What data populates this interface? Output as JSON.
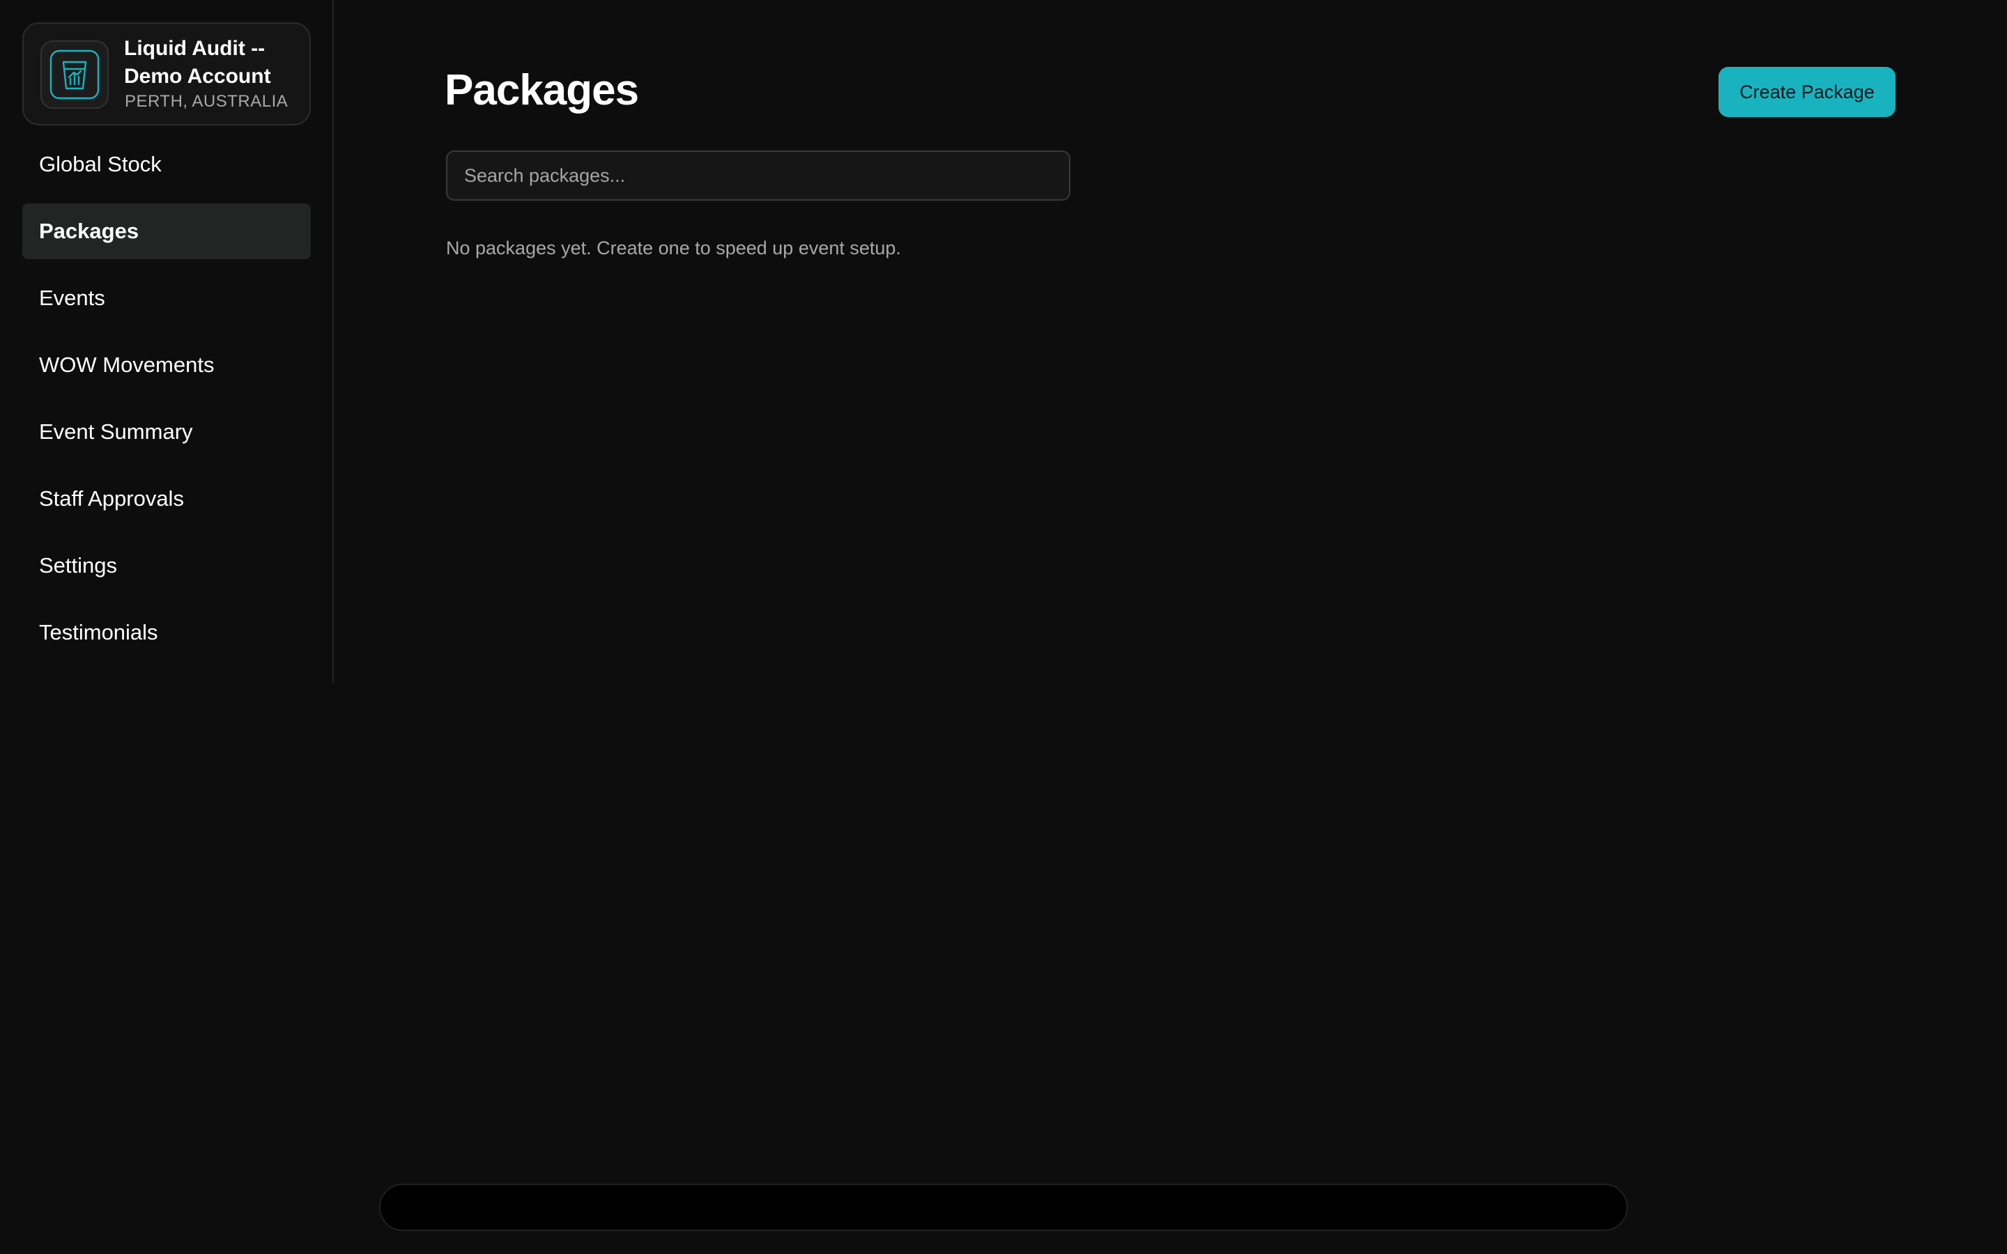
{
  "account": {
    "name": "Liquid Audit -- Demo Account",
    "location": "PERTH, AUSTRALIA",
    "logo_icon": "glass-chart-icon",
    "logo_color": "#19b3c0"
  },
  "sidebar": {
    "items": [
      {
        "label": "Global Stock",
        "active": false
      },
      {
        "label": "Packages",
        "active": true
      },
      {
        "label": "Events",
        "active": false
      },
      {
        "label": "WOW Movements",
        "active": false
      },
      {
        "label": "Event Summary",
        "active": false
      },
      {
        "label": "Staff Approvals",
        "active": false
      },
      {
        "label": "Settings",
        "active": false
      },
      {
        "label": "Testimonials",
        "active": false
      }
    ]
  },
  "main": {
    "title": "Packages",
    "create_button_label": "Create Package",
    "search": {
      "value": "",
      "placeholder": "Search packages..."
    },
    "empty_message": "No packages yet. Create one to speed up event setup."
  },
  "colors": {
    "accent": "#19b3c0",
    "background": "#0d0d0d",
    "active_item_bg": "#232525"
  }
}
